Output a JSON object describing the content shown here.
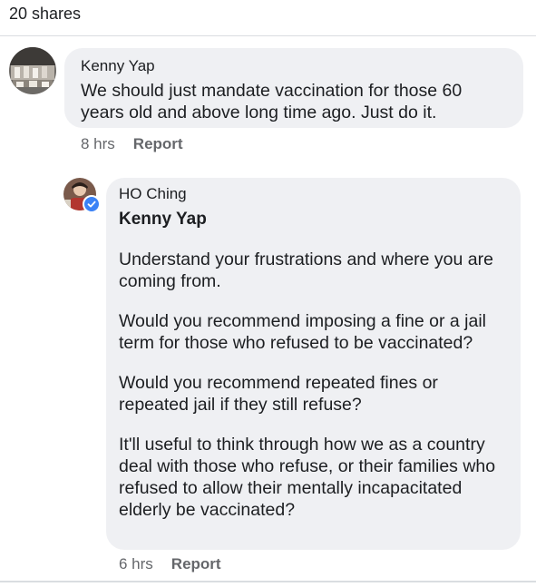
{
  "post": {
    "shares_text": "20 shares"
  },
  "comments": [
    {
      "author": "Kenny Yap",
      "text": "We should just mandate vaccination for those 60 years old and above long time ago. Just do it.",
      "time": "8 hrs",
      "action": "Report",
      "avatar_icon": "avatar-photo-icon"
    }
  ],
  "reply": {
    "author": "HO Ching",
    "mention": "Kenny Yap",
    "paragraphs": [
      "Understand your frustrations and where you are coming from.",
      "Would you recommend imposing a fine or a jail term for those who refused to be vaccinated?",
      "Would you recommend repeated fines or repeated jail if they still refuse?",
      "It'll useful to think through how we as a country deal with those who refuse, or their families who refused to allow their mentally incapacitated elderly be vaccinated?"
    ],
    "time": "6 hrs",
    "action": "Report",
    "avatar_icon": "avatar-photo-icon",
    "badge_icon": "verified-check-icon"
  },
  "colors": {
    "bubble": "#eff0f3",
    "meta_text": "#65676b",
    "verified": "#3b82f6"
  }
}
